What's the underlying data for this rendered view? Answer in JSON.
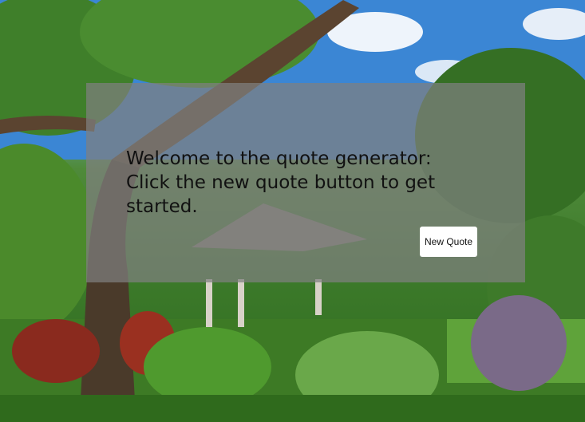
{
  "quote": {
    "text": "Welcome to the quote generator: Click the new quote button to get started."
  },
  "button": {
    "new_quote_label": "New Quote"
  },
  "colors": {
    "overlay": "#808080",
    "button_bg": "#ffffff",
    "text": "#111111"
  }
}
